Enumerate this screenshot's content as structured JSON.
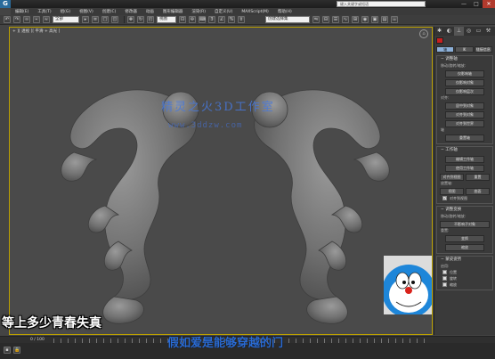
{
  "titlebar": {
    "logo": "G",
    "title": "",
    "search_text": "键入关键字或短语",
    "minimize": "—",
    "maximize": "□",
    "close": "✕"
  },
  "menu": [
    "编辑(E)",
    "工具(T)",
    "组(G)",
    "视图(V)",
    "创建(C)",
    "修改器",
    "动画",
    "图形编辑器",
    "渲染(R)",
    "自定义(U)",
    "MAXScript(M)",
    "帮助(H)"
  ],
  "toolbar": {
    "selection_filter": "全部",
    "ref_coord": "视图",
    "named_selection": "创建选择集"
  },
  "viewport": {
    "label": "+ ][ 透视 ][ 平滑 + 高光 ]",
    "watermark_title": "精灵之火3D工作室",
    "watermark_url": "www.3ddzw.com"
  },
  "panel": {
    "mode_pivot": "轴",
    "mode_ik": "IK",
    "mode_link_info": "链接信息",
    "adjust_pivot": {
      "title": "调整轴",
      "sub1": "移动/旋转/缩放:",
      "btn1": "仅影响轴",
      "btn2": "仅影响对象",
      "btn3": "仅影响层次",
      "sub2": "对齐:",
      "btn4": "居中到对象",
      "btn5": "对齐到对象",
      "btn6": "对齐到世界",
      "sub3": "轴",
      "btn7": "重置轴"
    },
    "working_pivot": {
      "title": "工作轴",
      "btn1": "编辑工作轴",
      "btn2": "使用工作轴",
      "btn3": "对齐到视图",
      "btn4": "重置",
      "sub1": "放置轴:",
      "btn5": "视图",
      "btn6": "曲面",
      "check1": "对齐到视图"
    },
    "adjust_transform": {
      "title": "调整变换",
      "sub1": "移动/旋转/缩放:",
      "btn1": "不影响子对象",
      "sub2": "重置:",
      "btn2": "变换",
      "btn3": "缩放"
    },
    "skin_pose": {
      "title": "蒙皮姿势",
      "sub1": "启用:",
      "check1": "位置",
      "check2": "旋转",
      "check3": "缩放"
    }
  },
  "timeline": {
    "frame": "0 / 100"
  },
  "subtitles": {
    "left": "等上多少青春失真",
    "main": "假如爱是能够穿越的门"
  }
}
